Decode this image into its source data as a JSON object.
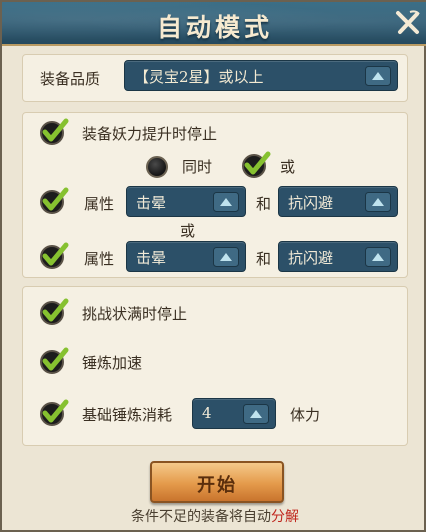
{
  "title": "自动模式",
  "quality": {
    "label": "装备品质",
    "value": "【灵宝2星】或以上"
  },
  "demon_power": {
    "label": "装备妖力提升时停止",
    "mode_both": "同时",
    "mode_or": "或",
    "mode_selected": "或"
  },
  "attr_rows": [
    {
      "label": "属性",
      "first": "击晕",
      "joiner": "和",
      "second": "抗闪避"
    },
    {
      "label": "属性",
      "first": "击晕",
      "joiner": "和",
      "second": "抗闪避"
    }
  ],
  "attr_or": "或",
  "options": {
    "stop_full": "挑战状满时停止",
    "speed_up": "锤炼加速",
    "basic_cost_label": "基础锤炼消耗",
    "basic_cost_value": "4",
    "basic_cost_unit": "体力"
  },
  "start_label": "开始",
  "footnote": {
    "text": "条件不足的装备将自动",
    "accent": "分解"
  },
  "colors": {
    "title_bar": "#2f5b73",
    "dropdown": "#2c5068",
    "check_mark": "#7fb82a",
    "start_button": "#e49a4b",
    "accent_red": "#c0281e"
  },
  "icons": {
    "close": "close-icon",
    "check": "check-icon",
    "dropdown_arrow": "triangle-up-icon"
  }
}
